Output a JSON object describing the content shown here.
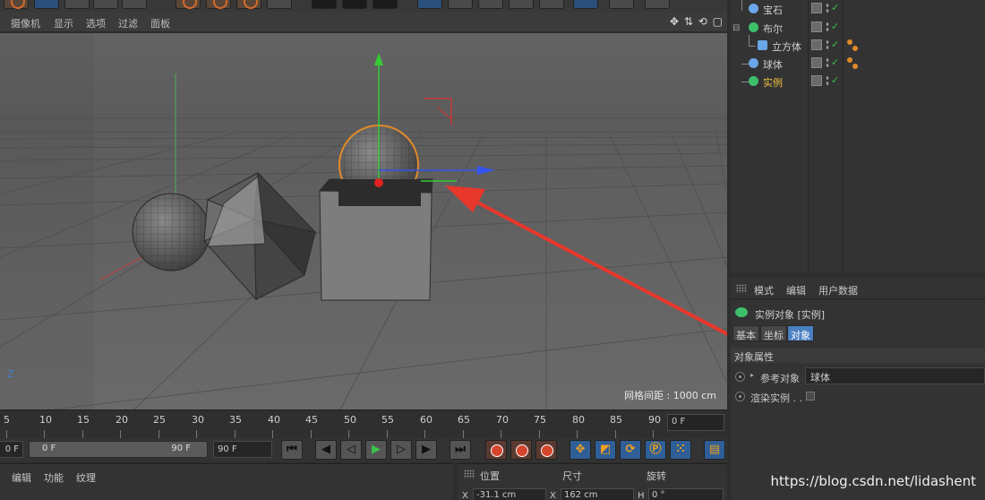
{
  "viewport_menu": {
    "items": [
      "摄像机",
      "显示",
      "选项",
      "过滤",
      "面板"
    ],
    "nav_icons": "✥ ⇅ ⟲ ▢"
  },
  "viewport": {
    "grid_spacing": "网格间距 : 1000 cm",
    "axis_label": "Z"
  },
  "timeline": {
    "ticks": [
      "5",
      "10",
      "15",
      "20",
      "25",
      "30",
      "35",
      "40",
      "45",
      "50",
      "55",
      "60",
      "65",
      "70",
      "75",
      "80",
      "85",
      "90"
    ],
    "current_frame": "0 F"
  },
  "playback": {
    "start_frame": "0 F",
    "slider_start": "0 F",
    "slider_end": "90 F",
    "end_frame": "90 F"
  },
  "material_bar": {
    "items": [
      "编辑",
      "功能",
      "纹理"
    ]
  },
  "coords_bar": {
    "headers": [
      "位置",
      "尺寸",
      "旋转"
    ],
    "x_pos": "-31.1 cm",
    "x_size": "162 cm",
    "h_rot": "0 °",
    "axis_x": "X",
    "axis_x2": "X",
    "axis_h": "H"
  },
  "object_manager": {
    "objects": [
      {
        "name": "宝石",
        "icon_color": "#6aa6e8",
        "active": false
      },
      {
        "name": "布尔",
        "icon_color": "#3fbf6a",
        "active": false
      },
      {
        "name": "立方体",
        "icon_color": "#6aa6e8",
        "active": false
      },
      {
        "name": "球体",
        "icon_color": "#6aa6e8",
        "active": false
      },
      {
        "name": "实例",
        "icon_color": "#3fbf6a",
        "active": true
      }
    ]
  },
  "attr_manager": {
    "menu": [
      "模式",
      "编辑",
      "用户数据"
    ],
    "title": "实例对象 [实例]",
    "tabs": [
      "基本",
      "坐标",
      "对象"
    ],
    "active_tab": "对象",
    "section": "对象属性",
    "ref_label": "参考对象",
    "ref_value": "球体",
    "render_label": "渲染实例 . ."
  },
  "watermark": "https://blog.csdn.net/lidashent",
  "colors": {
    "accent": "#4a7fc1",
    "arrow": "#e8372b",
    "check": "#38c24a",
    "active_text": "#f0c040"
  }
}
